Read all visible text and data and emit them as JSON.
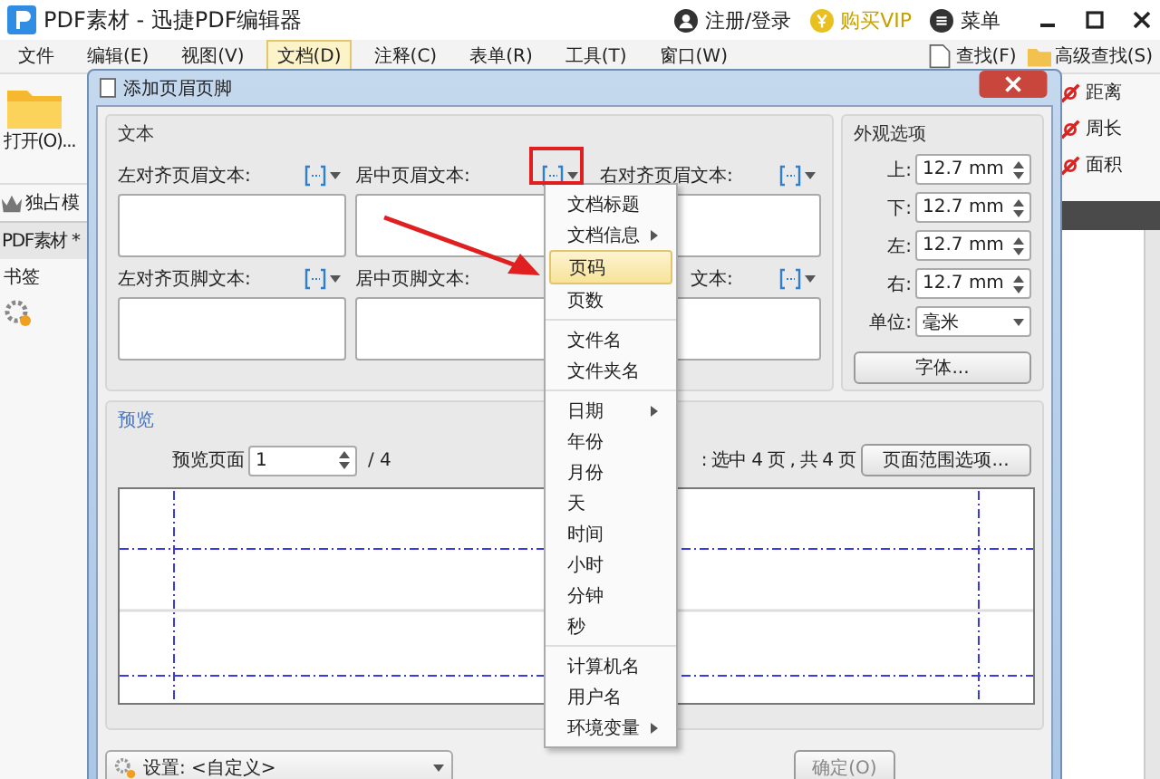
{
  "app": {
    "title": "PDF素材 - 迅捷PDF编辑器",
    "account": "注册/登录",
    "vip": "购买VIP",
    "menu": "菜单"
  },
  "menubar": {
    "items": [
      {
        "label": "文件",
        "selected": false
      },
      {
        "label": "编辑(E)",
        "selected": false
      },
      {
        "label": "视图(V)",
        "selected": false
      },
      {
        "label": "文档(D)",
        "selected": true
      },
      {
        "label": "注释(C)",
        "selected": false
      },
      {
        "label": "表单(R)",
        "selected": false
      },
      {
        "label": "工具(T)",
        "selected": false
      },
      {
        "label": "窗口(W)",
        "selected": false
      }
    ],
    "find": "查找(F)",
    "advanced_find": "高级查找(S)"
  },
  "left_panel": {
    "open": "打开(O)...",
    "exclusive": "独占模",
    "tab": "PDF素材 *",
    "bookmarks": "书签"
  },
  "measure_tools": [
    "距离",
    "周长",
    "面积"
  ],
  "dialog": {
    "title": "添加页眉页脚",
    "text_group": {
      "title": "文本",
      "fields": [
        {
          "label": "左对齐页眉文本:",
          "insert_button": true
        },
        {
          "label": "居中页眉文本:",
          "insert_button": true
        },
        {
          "label": "右对齐页眉文本:",
          "insert_button": true
        },
        {
          "label": "左对齐页脚文本:",
          "insert_button": true
        },
        {
          "label": "居中页脚文本:",
          "insert_button": false
        },
        {
          "label": "文本:",
          "insert_button": true
        }
      ]
    },
    "appearance": {
      "title": "外观选项",
      "margins": [
        {
          "label": "上:",
          "value": "12.7 mm"
        },
        {
          "label": "下:",
          "value": "12.7 mm"
        },
        {
          "label": "左:",
          "value": "12.7 mm"
        },
        {
          "label": "右:",
          "value": "12.7 mm"
        }
      ],
      "unit_label": "单位:",
      "unit": "毫米",
      "font_button": "字体..."
    },
    "preview": {
      "title": "预览",
      "page_label": "预览页面",
      "page_value": "1",
      "page_total": "/ 4",
      "range_text": ": 选中 4 页 , 共 4 页",
      "range_button": "页面范围选项..."
    },
    "settings": "设置: <自定义>",
    "ok": "确定(O)"
  },
  "insert_menu": {
    "groups": [
      [
        {
          "label": "文档标题",
          "submenu": false,
          "selected": false
        },
        {
          "label": "文档信息",
          "submenu": true,
          "selected": false
        },
        {
          "label": "页码",
          "submenu": false,
          "selected": true
        },
        {
          "label": "页数",
          "submenu": false,
          "selected": false
        }
      ],
      [
        {
          "label": "文件名",
          "submenu": false,
          "selected": false
        },
        {
          "label": "文件夹名",
          "submenu": false,
          "selected": false
        }
      ],
      [
        {
          "label": "日期",
          "submenu": true,
          "selected": false
        },
        {
          "label": "年份",
          "submenu": false,
          "selected": false
        },
        {
          "label": "月份",
          "submenu": false,
          "selected": false
        },
        {
          "label": "天",
          "submenu": false,
          "selected": false
        },
        {
          "label": "时间",
          "submenu": false,
          "selected": false
        },
        {
          "label": "小时",
          "submenu": false,
          "selected": false
        },
        {
          "label": "分钟",
          "submenu": false,
          "selected": false
        },
        {
          "label": "秒",
          "submenu": false,
          "selected": false
        }
      ],
      [
        {
          "label": "计算机名",
          "submenu": false,
          "selected": false
        },
        {
          "label": "用户名",
          "submenu": false,
          "selected": false
        },
        {
          "label": "环境变量",
          "submenu": true,
          "selected": false
        }
      ]
    ]
  }
}
